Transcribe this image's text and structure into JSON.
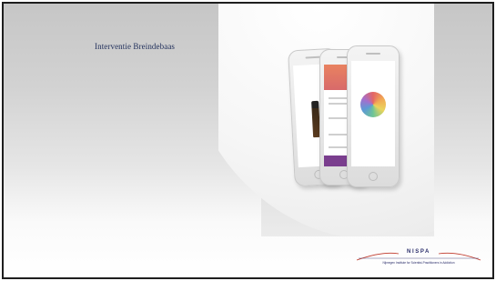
{
  "slide": {
    "title": "Interventie Breindebaas"
  },
  "image": {
    "description_icon": "smartphones-app-mockup",
    "accent_colors": [
      "#f27d47",
      "#7a3e8e",
      "#4b8fd0"
    ]
  },
  "logo": {
    "name": "NISPA",
    "tagline": "Nijmegen Institute for Scientist-Practitioners in Addiction",
    "color": "#2b2e6b",
    "swoosh_color": "#c0392b"
  }
}
